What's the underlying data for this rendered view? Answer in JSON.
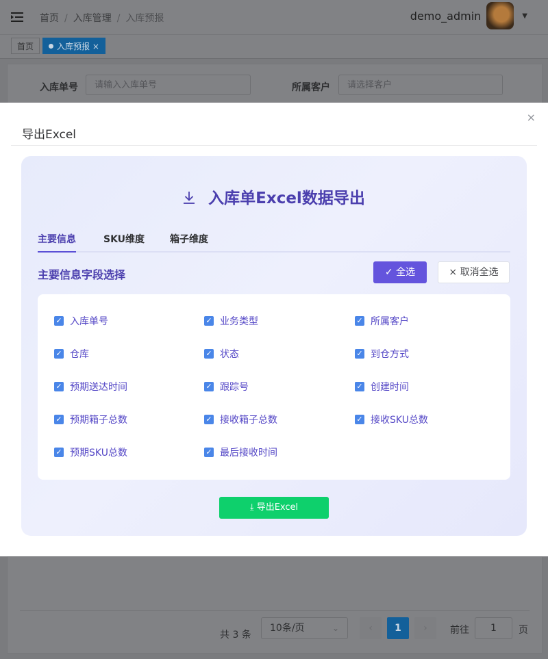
{
  "header": {
    "breadcrumb": [
      "首页",
      "入库管理",
      "入库预报"
    ],
    "breadcrumb_sep": "/",
    "username": "demo_admin",
    "hamburger_icon": "menu-fold-icon",
    "caret_icon": "caret-down-icon"
  },
  "tags": {
    "home": "首页",
    "active": "入库预报",
    "close_glyph": "×"
  },
  "search": {
    "order_label": "入库单号",
    "order_placeholder": "请输入入库单号",
    "customer_label": "所属客户",
    "customer_placeholder": "请选择客户"
  },
  "pagination": {
    "total": "共 3 条",
    "page_size": "10条/页",
    "prev": "‹",
    "next": "›",
    "current": "1",
    "goto_label": "前往",
    "goto_value": "1",
    "page_unit": "页"
  },
  "dialog": {
    "title": "导出Excel",
    "close_glyph": "×",
    "panel_title": "入库单Excel数据导出",
    "tabs": [
      "主要信息",
      "SKU维度",
      "箱子维度"
    ],
    "section_title": "主要信息字段选择",
    "select_all": "全选",
    "cancel_all": "取消全选",
    "fields": [
      {
        "label": "入库单号",
        "checked": true
      },
      {
        "label": "业务类型",
        "checked": true
      },
      {
        "label": "所属客户",
        "checked": true
      },
      {
        "label": "仓库",
        "checked": true
      },
      {
        "label": "状态",
        "checked": true
      },
      {
        "label": "到仓方式",
        "checked": true
      },
      {
        "label": "预期送达时间",
        "checked": true
      },
      {
        "label": "跟踪号",
        "checked": true
      },
      {
        "label": "创建时间",
        "checked": true
      },
      {
        "label": "预期箱子总数",
        "checked": true
      },
      {
        "label": "接收箱子总数",
        "checked": true
      },
      {
        "label": "接收SKU总数",
        "checked": true
      },
      {
        "label": "预期SKU总数",
        "checked": true
      },
      {
        "label": "最后接收时间",
        "checked": true
      }
    ],
    "export_button": "导出Excel"
  },
  "colors": {
    "accent": "#6454dd",
    "title_purple": "#4b3fae",
    "checkbox_blue": "#4a86e8",
    "export_green": "#0ed06c",
    "pager_active": "#13609a"
  }
}
